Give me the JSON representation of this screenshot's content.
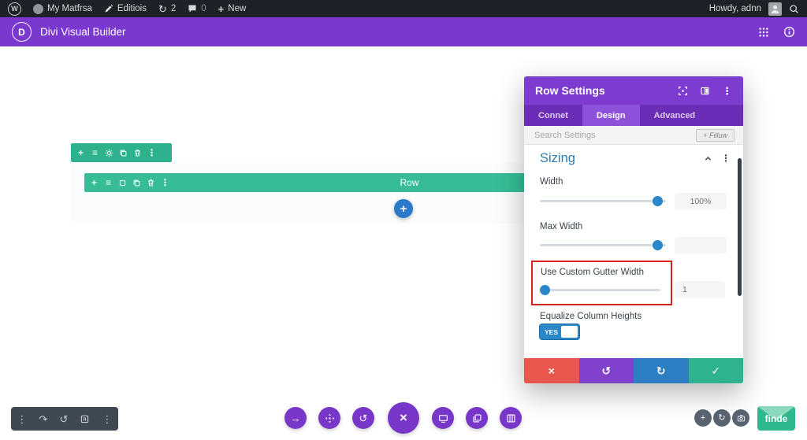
{
  "glyphs": {
    "plus": "+",
    "menu_lines": "≡",
    "dots_vertical": "⋮",
    "close": "×",
    "undo": "↺",
    "redo": "↻",
    "redo_alt": "↷",
    "check": "✓",
    "update": "↻",
    "arrow_right": "→"
  },
  "admin_bar": {
    "wp_logo_letter": "W",
    "site_name": "My Matfrsa",
    "edit_label": "Editiois",
    "updates_count": "2",
    "comments_count": "0",
    "new_label": "New",
    "greeting": "Howdy, adnn"
  },
  "divi_bar": {
    "logo_letter": "D",
    "title": "Divi Visual Builder"
  },
  "canvas": {
    "row_label": "Row"
  },
  "modal": {
    "title": "Row Settings",
    "tabs": {
      "content": "Connet",
      "design": "Design",
      "advanced": "Advanced"
    },
    "search_placeholder": "Search Settings",
    "filter_button": "+ Filluw",
    "section_heading": "Sizing",
    "width": {
      "label": "Width",
      "value": "100%",
      "slider_percent": 93
    },
    "max_width": {
      "label": "Max Width",
      "value": "",
      "slider_percent": 93
    },
    "gutter": {
      "label": "Use Custom Gutter Width",
      "value": "1",
      "slider_percent": 3
    },
    "equalize": {
      "label": "Equalize Column Heights",
      "toggle_value": "YES"
    }
  },
  "bottom_right": {
    "publish_label": "finde"
  },
  "colors": {
    "divi_purple": "#7b38cf",
    "section_toolbar_green": "#2eb28d",
    "row_toolbar_green": "#36bd97",
    "accent_blue": "#2b87c8",
    "highlight_red": "#d8231d",
    "footer_red": "#e8564e",
    "footer_purple": "#8141cb",
    "footer_blue": "#2e7ec4",
    "footer_green": "#2eb38e"
  }
}
